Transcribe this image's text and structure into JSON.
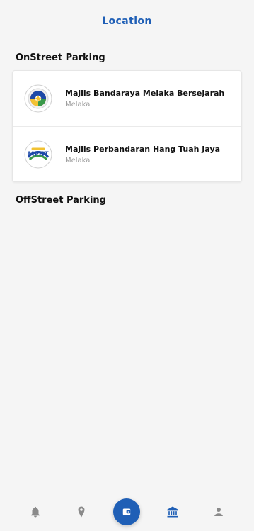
{
  "header": {
    "title": "Location"
  },
  "sections": [
    {
      "title": "OnStreet Parking",
      "items": [
        {
          "name": "Majlis Bandaraya Melaka Bersejarah",
          "city": "Melaka"
        },
        {
          "name": "Majlis Perbandaran Hang Tuah Jaya",
          "city": "Melaka"
        }
      ]
    },
    {
      "title": "OffStreet Parking"
    }
  ],
  "logos": {
    "mbmb": {
      "type": "emblem"
    },
    "mpht": {
      "text": "MPHT"
    }
  },
  "nav": {
    "items": [
      {
        "name": "notifications",
        "icon": "bell-icon"
      },
      {
        "name": "locations",
        "icon": "location-pin-icon"
      },
      {
        "name": "wallet",
        "icon": "wallet-icon"
      },
      {
        "name": "institution",
        "icon": "bank-icon"
      },
      {
        "name": "profile",
        "icon": "user-icon"
      }
    ]
  },
  "colors": {
    "accent": "#1f5fb6",
    "background": "#f5f5f5",
    "card": "#ffffff",
    "secondary_text": "#9b9b9b"
  }
}
